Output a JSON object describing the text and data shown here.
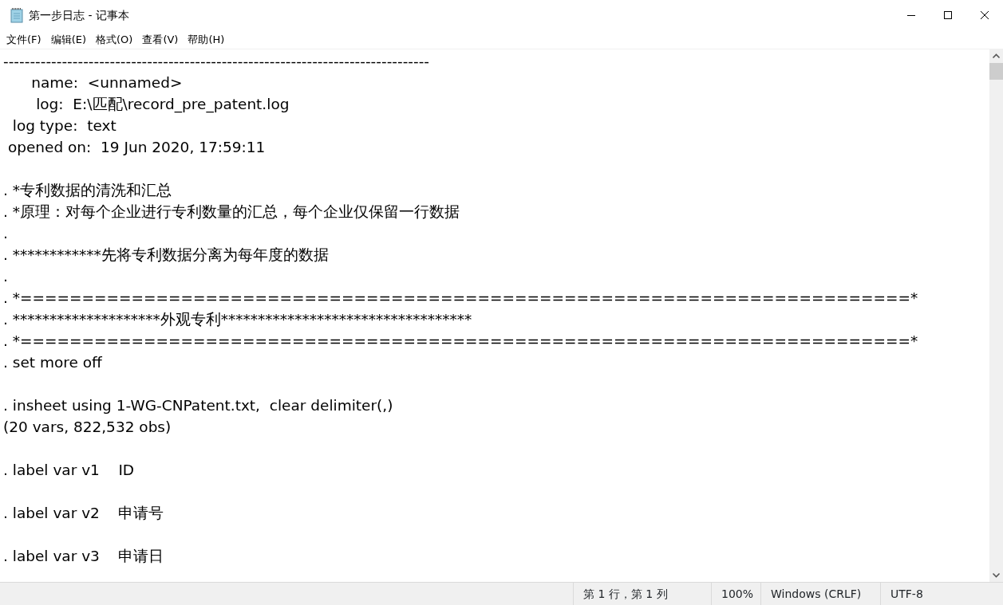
{
  "window": {
    "title": "第一步日志 - 记事本"
  },
  "menu": [
    {
      "label": "文件(F)"
    },
    {
      "label": "编辑(E)"
    },
    {
      "label": "格式(O)"
    },
    {
      "label": "查看(V)"
    },
    {
      "label": "帮助(H)"
    }
  ],
  "editor": {
    "lines": [
      {
        "kind": "text",
        "text": "--------------------------------------------------------------------------------"
      },
      {
        "kind": "text",
        "text": "      name:  <unnamed>"
      },
      {
        "kind": "text",
        "text": "       log:  E:\\匹配\\record_pre_patent.log"
      },
      {
        "kind": "text",
        "text": "  log type:  text"
      },
      {
        "kind": "text",
        "text": " opened on:  19 Jun 2020, 17:59:11"
      },
      {
        "kind": "blank"
      },
      {
        "kind": "text",
        "text": ". *专利数据的清洗和汇总"
      },
      {
        "kind": "text",
        "text": ". *原理：对每个企业进行专利数量的汇总，每个企业仅保留一行数据"
      },
      {
        "kind": "text",
        "text": "."
      },
      {
        "kind": "text",
        "text": ". ************先将专利数据分离为每年度的数据"
      },
      {
        "kind": "text",
        "text": "."
      },
      {
        "kind": "text",
        "text": ". *========================================================================*"
      },
      {
        "kind": "text",
        "text": ". ********************外观专利**********************************"
      },
      {
        "kind": "text",
        "text": ". *========================================================================*"
      },
      {
        "kind": "text",
        "text": ". set more off"
      },
      {
        "kind": "blank"
      },
      {
        "kind": "text",
        "text": ". insheet using 1-WG-CNPatent.txt,  clear delimiter(,)"
      },
      {
        "kind": "text",
        "text": "(20 vars, 822,532 obs)"
      },
      {
        "kind": "blank"
      },
      {
        "kind": "text",
        "text": ". label var v1    ID"
      },
      {
        "kind": "blank"
      },
      {
        "kind": "text",
        "text": ". label var v2    申请号"
      },
      {
        "kind": "blank"
      },
      {
        "kind": "text",
        "text": ". label var v3    申请日"
      }
    ]
  },
  "status_bar": [
    {
      "text": "第 1 行，第 1 列"
    },
    {
      "text": "100%"
    },
    {
      "text": "Windows (CRLF)"
    },
    {
      "text": "UTF-8"
    }
  ]
}
